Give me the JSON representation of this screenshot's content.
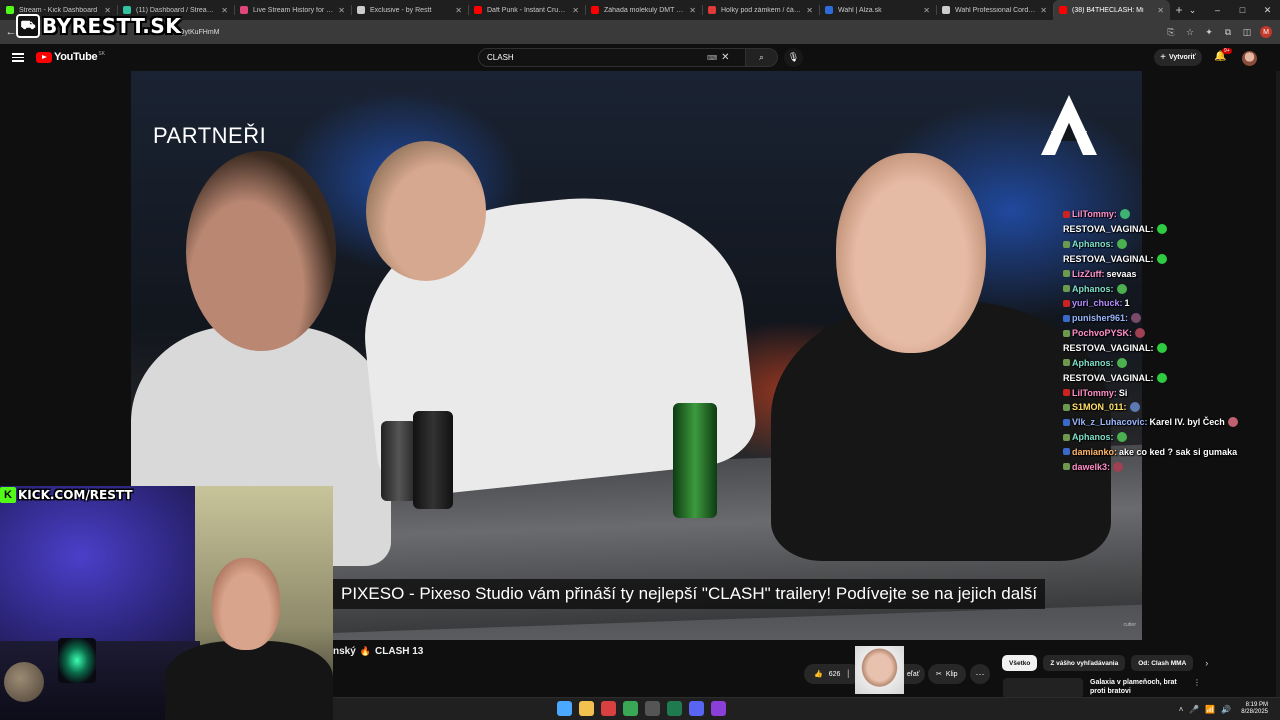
{
  "browser": {
    "tabs": [
      {
        "title": "Stream - Kick Dashboard",
        "color": "#53fc18"
      },
      {
        "title": "(11) Dashboard / Streamlabs",
        "color": "#31c3a2"
      },
      {
        "title": "Live Stream History for Blerp",
        "color": "#e0457b"
      },
      {
        "title": "Exclusive - by Restt",
        "color": "#cccccc"
      },
      {
        "title": "Daft Punk - Instant Crush (Vid",
        "color": "#ff0000"
      },
      {
        "title": "Záhada molekuly DMT a paral",
        "color": "#ff0000"
      },
      {
        "title": "Holky pod zámkem / část 1 - e",
        "color": "#e03a3a"
      },
      {
        "title": "Wahl | Alza.sk",
        "color": "#2c6bd9"
      },
      {
        "title": "Wahl Professional Cordless De",
        "color": "#cccccc"
      },
      {
        "title": "(38) B4THECLASH: Mi",
        "color": "#ff0000",
        "active": true
      }
    ],
    "new_tab": "+",
    "window_controls": [
      "⌄",
      "–",
      "□",
      "✕"
    ],
    "url": "CQytKuFHmM",
    "nav": {
      "back": "←"
    },
    "toolbar_icons": [
      "⎘",
      "☆",
      "✦",
      "⧉",
      "◫"
    ],
    "profile_letter": "M"
  },
  "overlay": {
    "brand_text": "BYRESTT.SK",
    "kick_text": "KICK.COM/RESTT",
    "kick_letter": "K"
  },
  "youtube": {
    "logo_text": "YouTube",
    "region": "SK",
    "search_value": "CLASH",
    "create_label": "Vytvoriť",
    "notif_count": "9+"
  },
  "video": {
    "corner_text": "PARTNEŘI",
    "subtitle": "PIXESO - Pixeso Studio vám přináší ty nejlepší \"CLASH\" trailery! Podívejte se na jejich další",
    "watermark": "cutter"
  },
  "chat": [
    {
      "user": "LilTommy",
      "color": "#ff8fc8",
      "msg": "",
      "emote": "#3cb371",
      "badge": "#cc2222"
    },
    {
      "user": "RESTOVA_VAGINAL",
      "color": "#ffffff",
      "msg": "",
      "emote": "#2ecc40",
      "badge": ""
    },
    {
      "user": "Aphanos",
      "color": "#7ee0c9",
      "msg": "",
      "emote": "#4caf50",
      "badge": "#6c9a4c"
    },
    {
      "user": "RESTOVA_VAGINAL",
      "color": "#ffffff",
      "msg": "",
      "emote": "#2ecc40",
      "badge": ""
    },
    {
      "user": "LizZuff",
      "color": "#ff8fc8",
      "msg": "sevaas",
      "emote": "",
      "badge": "#6c9a4c"
    },
    {
      "user": "Aphanos",
      "color": "#7ee0c9",
      "msg": "",
      "emote": "#4caf50",
      "badge": "#6c9a4c"
    },
    {
      "user": "yuri_chuck",
      "color": "#b58cff",
      "msg": "1",
      "emote": "",
      "badge": "#cc2222"
    },
    {
      "user": "punisher961",
      "color": "#9ab8ff",
      "msg": "",
      "emote": "#7a4a6a",
      "badge": "#3a6ac9"
    },
    {
      "user": "PochvoPYSK",
      "color": "#ff8fc8",
      "msg": "",
      "emote": "#a04050",
      "badge": "#6c9a4c"
    },
    {
      "user": "RESTOVA_VAGINAL",
      "color": "#ffffff",
      "msg": "",
      "emote": "#2ecc40",
      "badge": ""
    },
    {
      "user": "Aphanos",
      "color": "#7ee0c9",
      "msg": "",
      "emote": "#4caf50",
      "badge": "#6c9a4c"
    },
    {
      "user": "RESTOVA_VAGINAL",
      "color": "#ffffff",
      "msg": "",
      "emote": "#2ecc40",
      "badge": ""
    },
    {
      "user": "LilTommy",
      "color": "#ff8fc8",
      "msg": "Si",
      "emote": "",
      "badge": "#cc2222"
    },
    {
      "user": "S1MON_011",
      "color": "#ffe066",
      "msg": "",
      "emote": "#5a7ab0",
      "badge": "#6c9a4c"
    },
    {
      "user": "Vlk_z_Luhacovic",
      "color": "#9ab8ff",
      "msg": "Karel IV. byl Čech",
      "emote": "#c06070",
      "badge": "#3a6ac9"
    },
    {
      "user": "Aphanos",
      "color": "#7ee0c9",
      "msg": "",
      "emote": "#4caf50",
      "badge": "#6c9a4c"
    },
    {
      "user": "damianko",
      "color": "#ffb86b",
      "msg": "ake co ked ? sak si gumaka",
      "emote": "",
      "badge": "#3a6ac9"
    },
    {
      "user": "dawelk3",
      "color": "#ff8fc8",
      "msg": "",
      "emote": "#a04050",
      "badge": "#6c9a4c"
    }
  ],
  "below": {
    "title_left": "nský",
    "title_right": "CLASH 13",
    "like_count": "626",
    "share_label": "eľať",
    "clip_label": "Klip",
    "more": "···",
    "chips": [
      {
        "label": "Všetko",
        "active": true
      },
      {
        "label": "Z vášho vyhľadávania",
        "active": false
      },
      {
        "label": "Od: Clash MMA",
        "active": false
      }
    ],
    "rec_title": "Galaxia v plameňoch, brat proti bratovi"
  },
  "taskbar": {
    "apps": [
      "#4aa8ff",
      "#f2c14e",
      "#d94040",
      "#3aa757",
      "#555555",
      "#1f7a4f",
      "#5865f2",
      "#8b3fd9"
    ],
    "time": "8:19 PM",
    "date": "8/28/2025",
    "tray": [
      "˄",
      "🎤",
      "📶",
      "🔊"
    ]
  }
}
